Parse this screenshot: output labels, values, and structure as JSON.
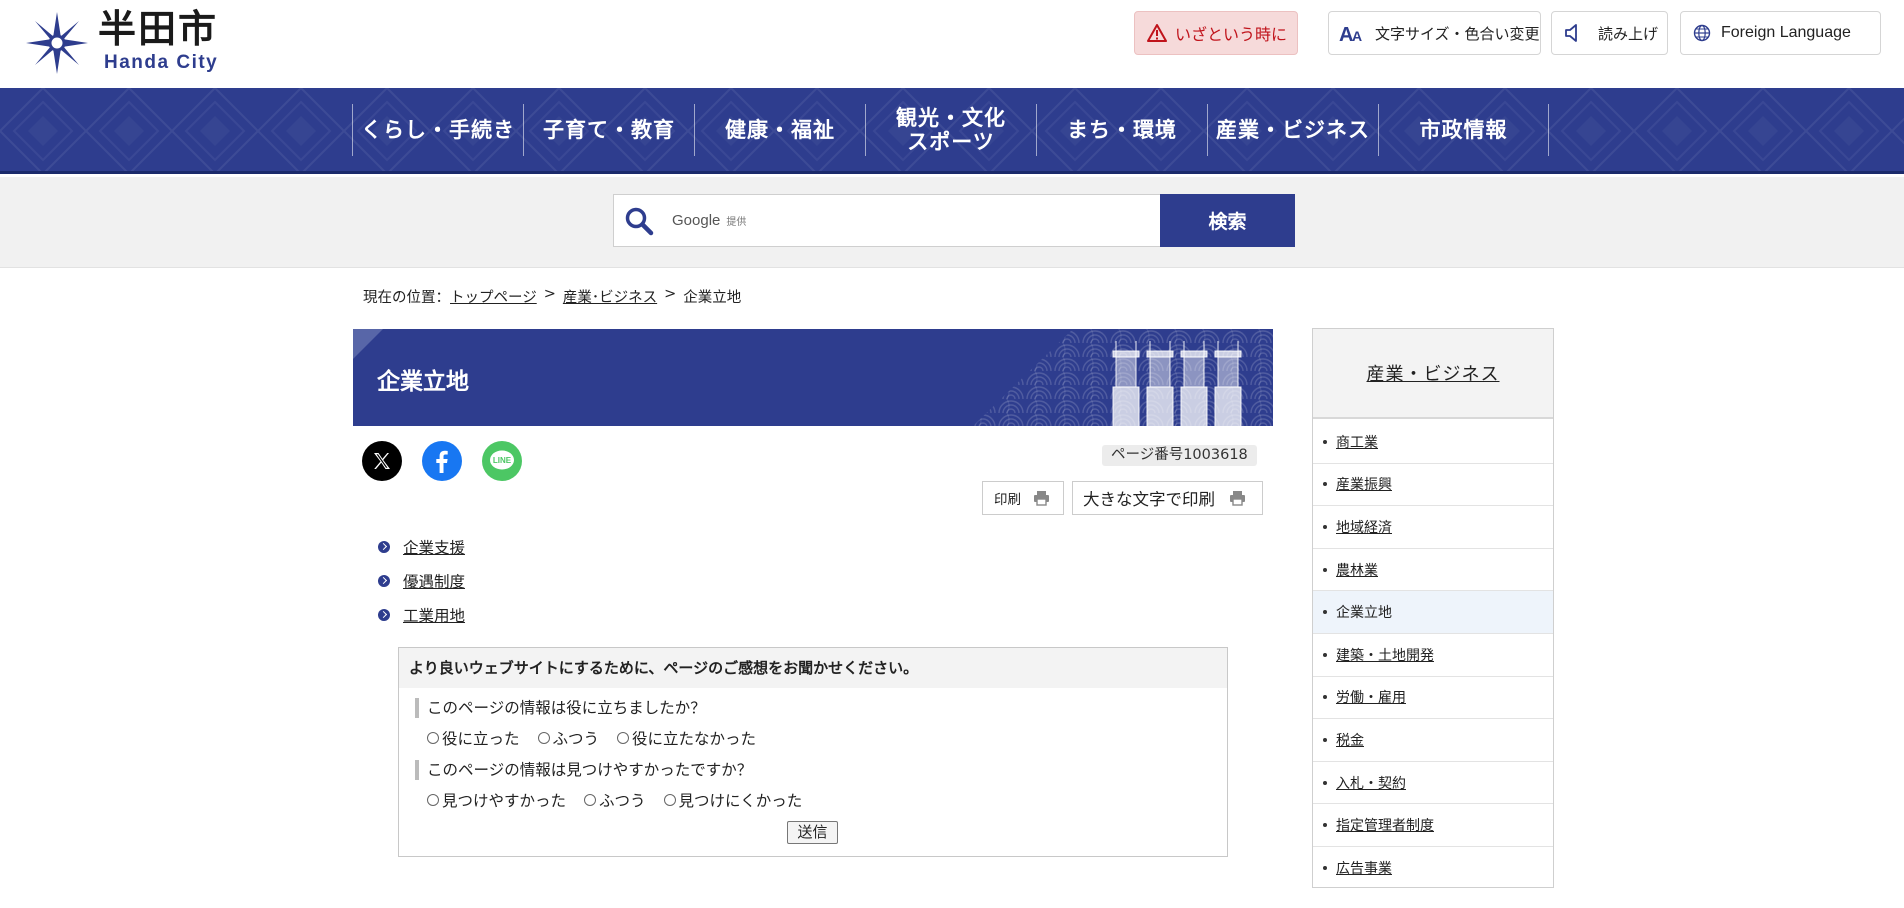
{
  "header": {
    "logo_jp": "半田市",
    "logo_en": "Handa City",
    "emergency_label": "いざという時に",
    "text_size_label": "文字サイズ・色合い変更",
    "read_aloud_label": "読み上げ",
    "foreign_language_label": "Foreign Language"
  },
  "nav": {
    "items": [
      {
        "label": "くらし・手続き"
      },
      {
        "label": "子育て・教育"
      },
      {
        "label": "健康・福祉"
      },
      {
        "label": "観光・文化\nスポーツ"
      },
      {
        "label": "まち・環境"
      },
      {
        "label": "産業・ビジネス"
      },
      {
        "label": "市政情報"
      }
    ]
  },
  "search": {
    "provider_label": "Google",
    "provider_sub": "提供",
    "button_label": "検索"
  },
  "breadcrumb": {
    "prefix": "現在の位置：",
    "items": [
      "トップページ",
      "産業･ビジネス",
      "企業立地"
    ],
    "separator": ">"
  },
  "page": {
    "title": "企業立地",
    "page_number": "ページ番号1003618",
    "print_label": "印刷",
    "print_large_label": "大きな文字で印刷"
  },
  "links": [
    "企業支援",
    "優遇制度",
    "工業用地"
  ],
  "survey": {
    "heading": "より良いウェブサイトにするために、ページのご感想をお聞かせください。",
    "q1": "このページの情報は役に立ちましたか？",
    "q1_options": [
      "役に立った",
      "ふつう",
      "役に立たなかった"
    ],
    "q2": "このページの情報は見つけやすかったですか？",
    "q2_options": [
      "見つけやすかった",
      "ふつう",
      "見つけにくかった"
    ],
    "submit_label": "送信"
  },
  "sidenav": {
    "heading": "産業・ビジネス",
    "items": [
      "商工業",
      "産業振興",
      "地域経済",
      "農林業",
      "企業立地",
      "建築・土地開発",
      "労働・雇用",
      "税金",
      "入札・契約",
      "指定管理者制度",
      "広告事業"
    ],
    "current": "企業立地"
  },
  "colors": {
    "brand_navy": "#2e3d8e",
    "emergency_bg": "#f6dada",
    "emergency_text": "#c0131b",
    "facebook_blue": "#1877f2",
    "line_green": "#06c755"
  }
}
